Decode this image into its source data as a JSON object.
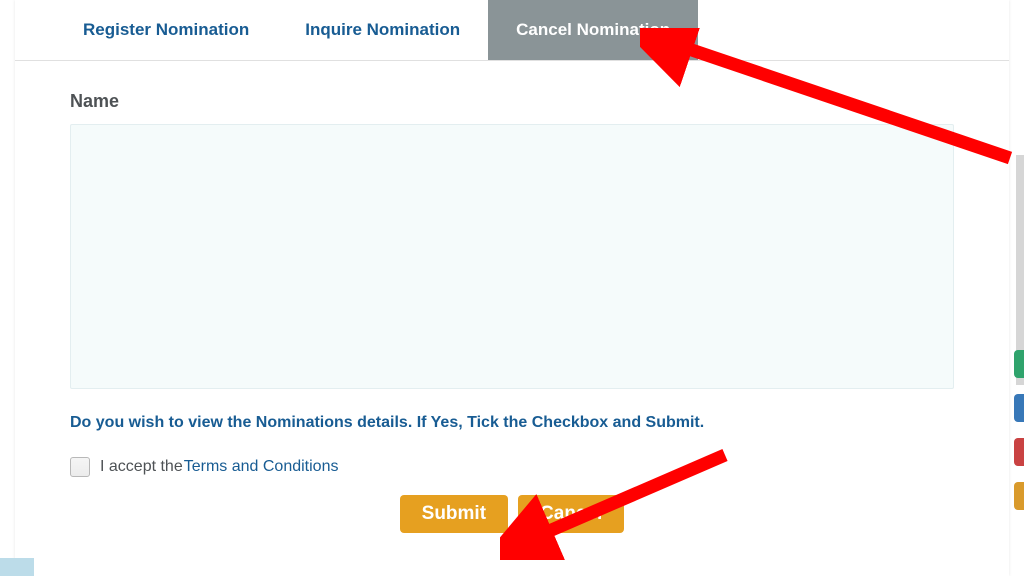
{
  "tabs": {
    "register": "Register Nomination",
    "inquire": "Inquire Nomination",
    "cancel": "Cancel Nomination"
  },
  "form": {
    "name_label": "Name",
    "name_value": "",
    "instruction": "Do you wish to view the Nominations details. If Yes, Tick the Checkbox and Submit.",
    "accept_prefix": "I accept the",
    "terms_link": "Terms and Conditions"
  },
  "buttons": {
    "submit": "Submit",
    "cancel": "Cancel"
  },
  "colors": {
    "tab_active_bg": "#8a9497",
    "link": "#185c93",
    "button_bg": "#e6a020",
    "arrow": "#ff0000"
  }
}
